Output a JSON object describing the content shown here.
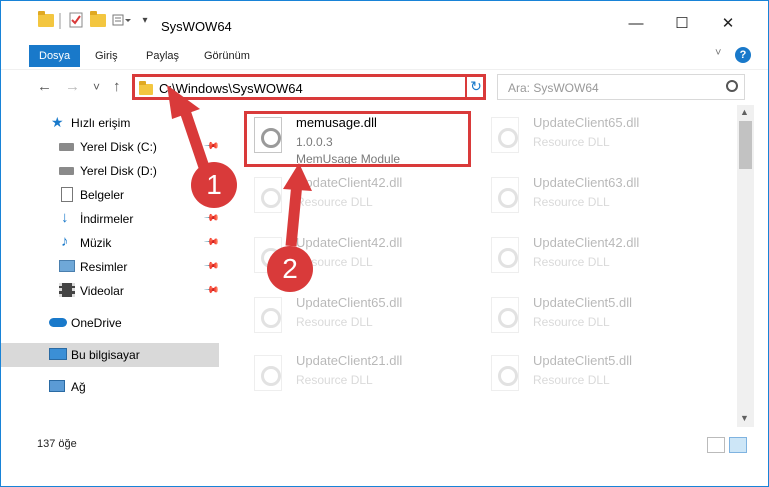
{
  "window": {
    "title": "SysWOW64",
    "controls": {
      "minimize": "—",
      "maximize": "☐",
      "close": "✕"
    }
  },
  "ribbon": {
    "tabs": [
      "Dosya",
      "Giriş",
      "Paylaş",
      "Görünüm"
    ],
    "active_tab": "Dosya",
    "help_label": "?"
  },
  "navigation": {
    "back": "←",
    "forward": "→",
    "recent": "˅",
    "up": "↑",
    "address": "C:\\Windows\\SysWOW64",
    "refresh": "↻",
    "dropdown": "˅",
    "search_placeholder": "Ara: SysWOW64"
  },
  "sidebar": {
    "items": [
      {
        "label": "Hızlı erişim",
        "icon": "star-icon",
        "pinned": false
      },
      {
        "label": "Yerel Disk (C:)",
        "icon": "drive-icon",
        "pinned": true
      },
      {
        "label": "Yerel Disk (D:)",
        "icon": "drive-icon",
        "pinned": true
      },
      {
        "label": "Belgeler",
        "icon": "document-icon",
        "pinned": true
      },
      {
        "label": "İndirmeler",
        "icon": "download-icon",
        "pinned": true
      },
      {
        "label": "Müzik",
        "icon": "music-icon",
        "pinned": true
      },
      {
        "label": "Resimler",
        "icon": "pictures-icon",
        "pinned": true
      },
      {
        "label": "Videolar",
        "icon": "video-icon",
        "pinned": true
      },
      {
        "label": "OneDrive",
        "icon": "cloud-icon",
        "pinned": false
      },
      {
        "label": "Bu bilgisayar",
        "icon": "computer-icon",
        "pinned": false,
        "selected": true
      },
      {
        "label": "Ağ",
        "icon": "network-icon",
        "pinned": false
      }
    ]
  },
  "files": [
    {
      "name": "memusage.dll",
      "line2": "1.0.0.3",
      "line3": "MemUsage Module",
      "highlighted": true
    },
    {
      "name": "UpdateClient65.dll",
      "line2": "Resource DLL"
    },
    {
      "name": "UpdateClient42.dll",
      "line2": "Resource DLL"
    },
    {
      "name": "UpdateClient63.dll",
      "line2": "Resource DLL"
    },
    {
      "name": "UpdateClient42.dll",
      "line2": "Resource DLL"
    },
    {
      "name": "UpdateClient42.dll",
      "line2": "Resource DLL"
    },
    {
      "name": "UpdateClient65.dll",
      "line2": "Resource DLL"
    },
    {
      "name": "UpdateClient5.dll",
      "line2": "Resource DLL"
    },
    {
      "name": "UpdateClient21.dll",
      "line2": "Resource DLL"
    },
    {
      "name": "UpdateClient5.dll",
      "line2": "Resource DLL"
    }
  ],
  "status": {
    "item_count": "137 öğe"
  },
  "callouts": [
    "1",
    "2"
  ],
  "colors": {
    "accent": "#1979ca",
    "callout": "#d93a3a",
    "folder": "#f3c640"
  }
}
